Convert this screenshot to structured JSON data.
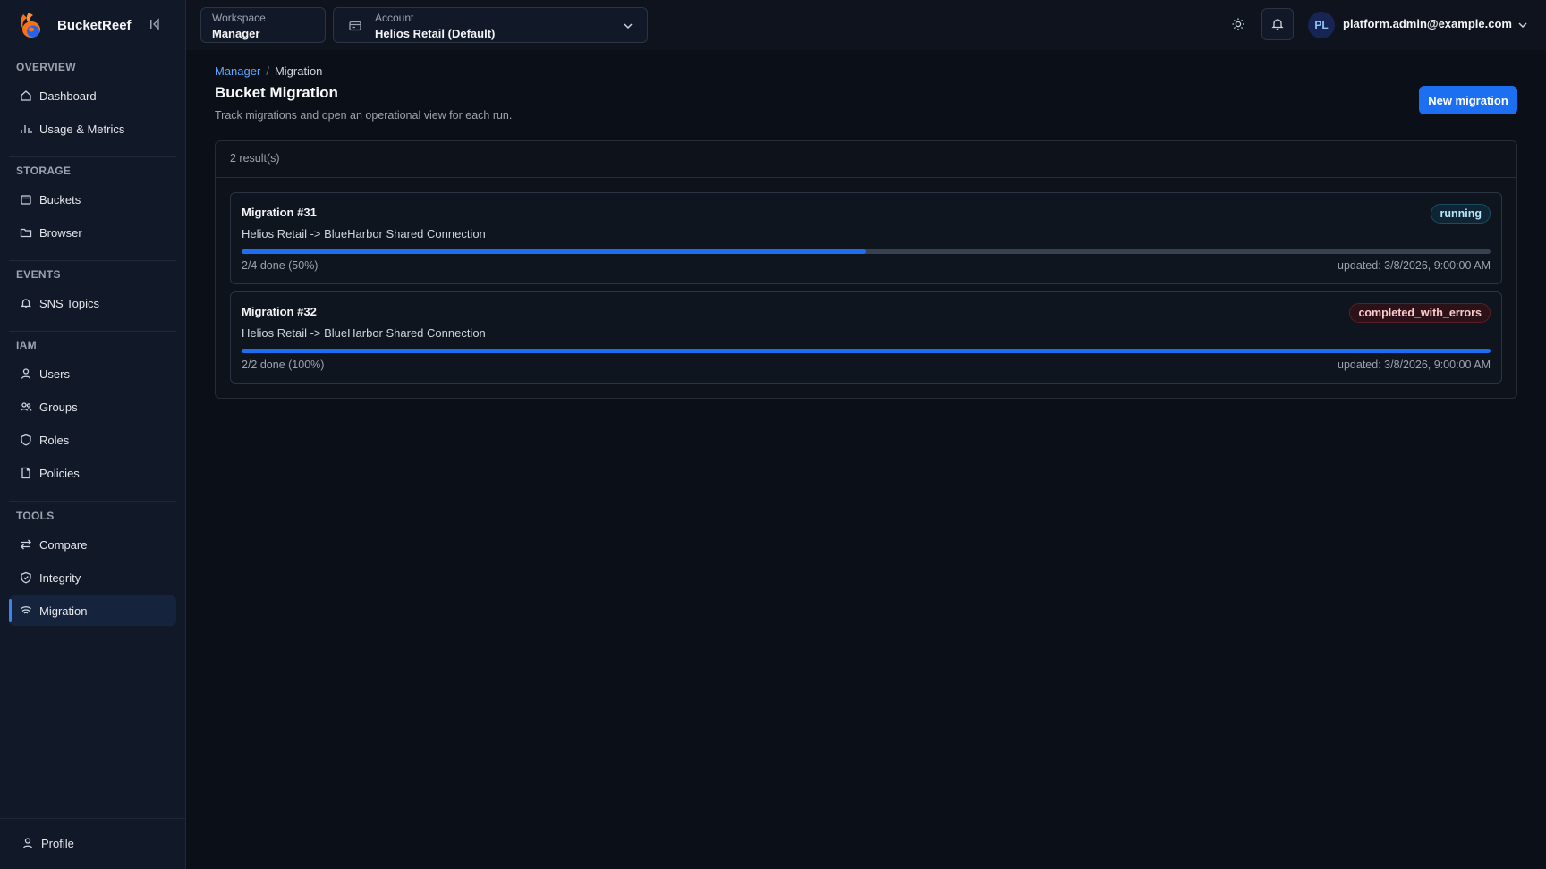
{
  "app": {
    "name": "BucketReef"
  },
  "sidebar": {
    "sections": [
      {
        "title": "OVERVIEW",
        "items": [
          {
            "label": "Dashboard",
            "icon": "home-icon"
          },
          {
            "label": "Usage & Metrics",
            "icon": "bar-chart-icon"
          }
        ]
      },
      {
        "title": "STORAGE",
        "items": [
          {
            "label": "Buckets",
            "icon": "bucket-icon"
          },
          {
            "label": "Browser",
            "icon": "folder-icon"
          }
        ]
      },
      {
        "title": "EVENTS",
        "items": [
          {
            "label": "SNS Topics",
            "icon": "bell-icon"
          }
        ]
      },
      {
        "title": "IAM",
        "items": [
          {
            "label": "Users",
            "icon": "user-icon"
          },
          {
            "label": "Groups",
            "icon": "users-icon"
          },
          {
            "label": "Roles",
            "icon": "shield-icon"
          },
          {
            "label": "Policies",
            "icon": "document-icon"
          }
        ]
      },
      {
        "title": "TOOLS",
        "items": [
          {
            "label": "Compare",
            "icon": "compare-icon"
          },
          {
            "label": "Integrity",
            "icon": "shield-check-icon"
          },
          {
            "label": "Migration",
            "icon": "migration-icon",
            "active": true
          }
        ]
      }
    ],
    "profile_label": "Profile"
  },
  "topbar": {
    "workspace": {
      "label": "Workspace",
      "value": "Manager"
    },
    "account": {
      "label": "Account",
      "value": "Helios Retail (Default)"
    },
    "user": {
      "initials": "PL",
      "email": "platform.admin@example.com"
    }
  },
  "breadcrumb": {
    "parent": "Manager",
    "separator": "/",
    "current": "Migration"
  },
  "page": {
    "title": "Bucket Migration",
    "subtitle": "Track migrations and open an operational view for each run.",
    "new_button": "New migration"
  },
  "results": {
    "count_label": "2 result(s)",
    "migrations": [
      {
        "title": "Migration #31",
        "route": "Helios Retail -> BlueHarbor Shared Connection",
        "status": "running",
        "progress_fraction": 0.5,
        "progress_text": "2/4 done (50%)",
        "updated": "updated: 3/8/2026, 9:00:00 AM"
      },
      {
        "title": "Migration #32",
        "route": "Helios Retail -> BlueHarbor Shared Connection",
        "status": "completed_with_errors",
        "progress_fraction": 1.0,
        "progress_text": "2/2 done (100%)",
        "updated": "updated: 3/8/2026, 9:00:00 AM"
      }
    ]
  },
  "colors": {
    "accent": "#1d6ff2",
    "background": "#0b0f17",
    "sidebar": "#111827"
  }
}
